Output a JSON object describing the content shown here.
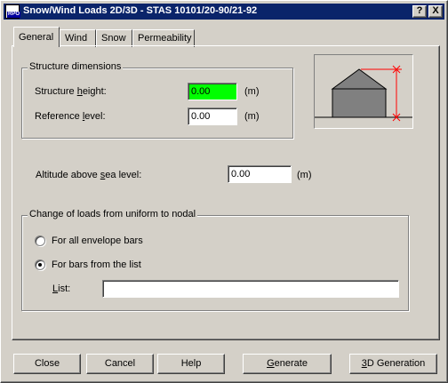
{
  "window": {
    "title": "Snow/Wind Loads 2D/3D - STAS 10101/20-90/21-92",
    "help_button": "?",
    "close_button": "X"
  },
  "tabs": [
    {
      "label": "General",
      "active": true
    },
    {
      "label": "Wind",
      "active": false
    },
    {
      "label": "Snow",
      "active": false
    },
    {
      "label": "Permeability",
      "active": false
    }
  ],
  "structure_dimensions": {
    "group_title": "Structure dimensions",
    "height_label_pre": "Structure ",
    "height_label_ul": "h",
    "height_label_post": "eight:",
    "height_value": "0.00",
    "height_unit": "(m)",
    "height_field_color": "#00ff00",
    "reference_label_pre": "Reference ",
    "reference_label_ul": "l",
    "reference_label_post": "evel:",
    "reference_value": "0.00",
    "reference_unit": "(m)"
  },
  "altitude": {
    "label_pre": "Altitude above ",
    "label_ul": "s",
    "label_post": "ea level:",
    "value": "0.00",
    "unit": "(m)"
  },
  "load_change": {
    "group_title": "Change of loads from uniform to nodal",
    "option_all": "For all envelope bars",
    "option_list": "For bars from the list",
    "selected": "list",
    "list_label_ul": "L",
    "list_label_post": "ist:",
    "list_value": ""
  },
  "buttons": {
    "close": "Close",
    "cancel": "Cancel",
    "help": "Help",
    "generate_ul": "G",
    "generate_post": "enerate",
    "gen3d_ul": "3",
    "gen3d_post": "D Generation"
  },
  "preview": {
    "icon": "building-height-diagram-icon",
    "dimension_color": "#ff0000",
    "house_fill": "#808080"
  }
}
